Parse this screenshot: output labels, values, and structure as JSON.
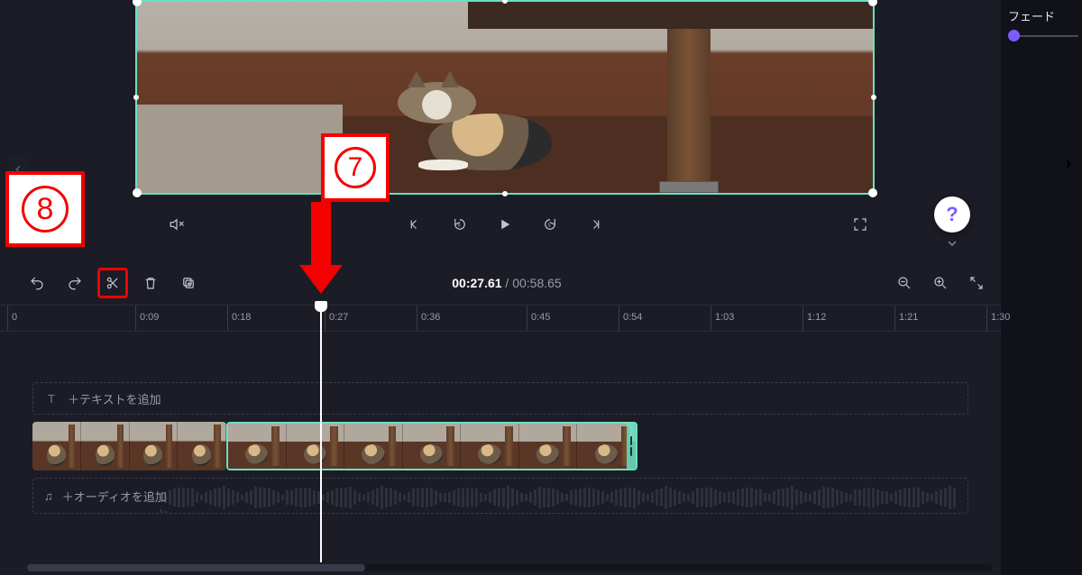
{
  "rpanel": {
    "fade_label": "フェード"
  },
  "playbar": {
    "mute": "mute",
    "prev": "prev-frame",
    "back5": "back-5s",
    "play": "play",
    "fwd5": "forward-5s",
    "next": "next-frame",
    "fullscreen": "fullscreen"
  },
  "help": {
    "glyph": "?"
  },
  "time": {
    "current": "00:27.61",
    "sep": " / ",
    "total": "00:58.65"
  },
  "toolbar": {
    "undo": "undo",
    "redo": "redo",
    "split": "split",
    "delete": "delete",
    "copy": "copy",
    "zoom_out": "zoom-out",
    "zoom_in": "zoom-in",
    "fit": "fit"
  },
  "ruler": {
    "ticks": [
      {
        "label": "0",
        "pos": 8
      },
      {
        "label": "0:09",
        "pos": 150
      },
      {
        "label": "0:18",
        "pos": 252
      },
      {
        "label": "0:27",
        "pos": 360
      },
      {
        "label": "0:36",
        "pos": 462
      },
      {
        "label": "0:45",
        "pos": 584
      },
      {
        "label": "0:54",
        "pos": 686
      },
      {
        "label": "1:03",
        "pos": 788
      },
      {
        "label": "1:12",
        "pos": 890
      },
      {
        "label": "1:21",
        "pos": 992
      },
      {
        "label": "1:30",
        "pos": 1094
      }
    ]
  },
  "tracks": {
    "text_placeholder": "＋テキストを追加",
    "text_icon": "T",
    "audio_placeholder": "＋オーディオを追加",
    "audio_icon": "♫"
  },
  "annotations": {
    "step7": "7",
    "step8": "8"
  }
}
